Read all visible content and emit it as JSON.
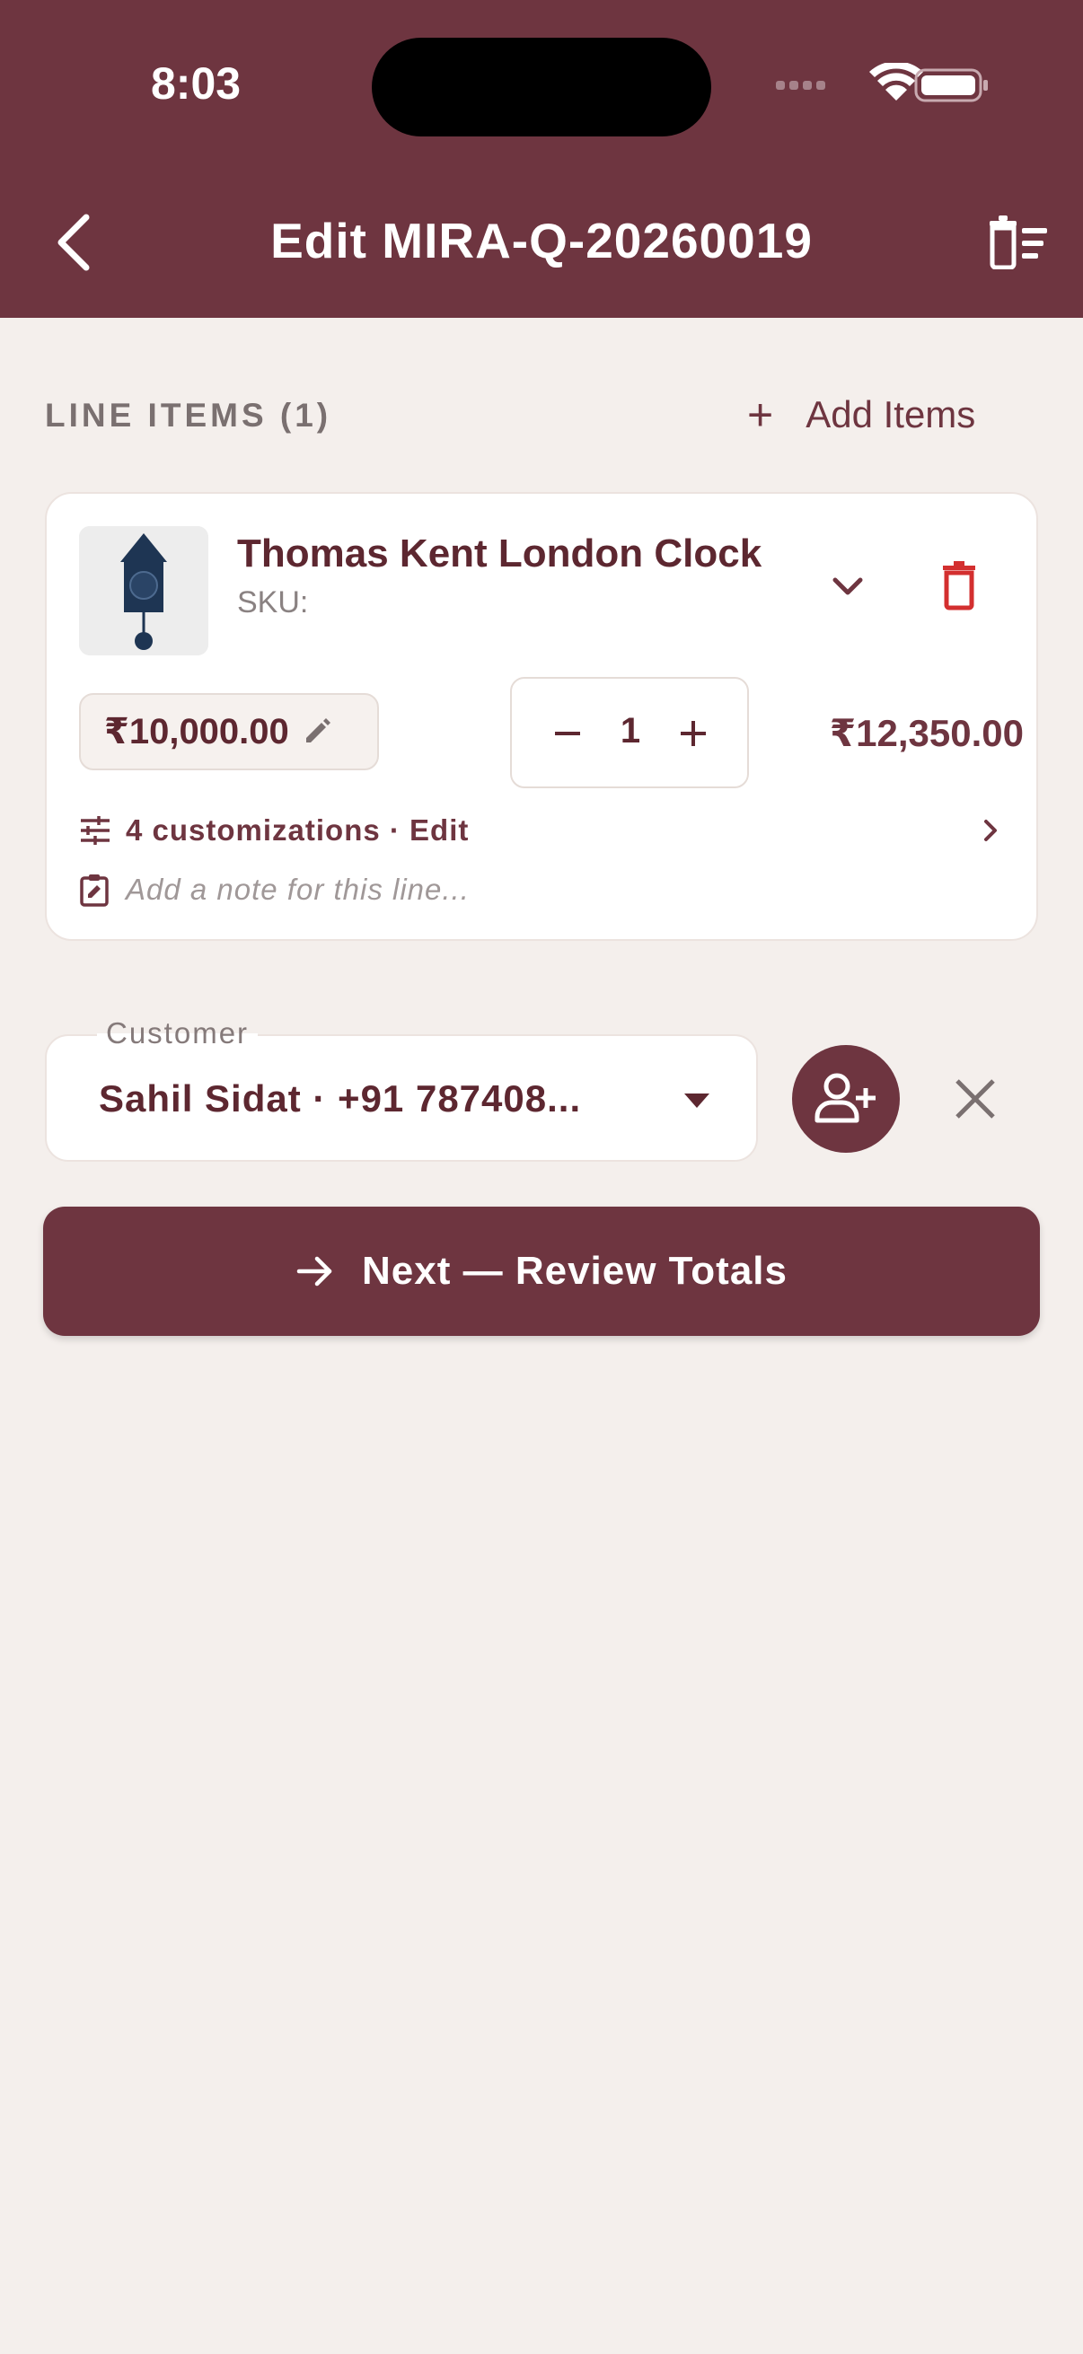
{
  "status_bar": {
    "time": "8:03"
  },
  "appbar": {
    "title": "Edit MIRA-Q-20260019"
  },
  "line_items": {
    "section_title": "LINE ITEMS (1)",
    "add_items_label": "Add Items",
    "items": [
      {
        "name": "Thomas Kent London Clock",
        "sku": "SKU:",
        "unit_price": "₹10,000.00",
        "quantity": "1",
        "line_total": "₹12,350.00",
        "customizations": "4 customizations · Edit",
        "note_placeholder": "Add a note for this line..."
      }
    ]
  },
  "customer": {
    "label": "Customer",
    "value": "Sahil Sidat · +91 787408..."
  },
  "next_button": {
    "label": "Next — Review Totals"
  },
  "colors": {
    "primary": "#6e3540",
    "background": "#f4efec",
    "danger": "#d32f2f"
  }
}
